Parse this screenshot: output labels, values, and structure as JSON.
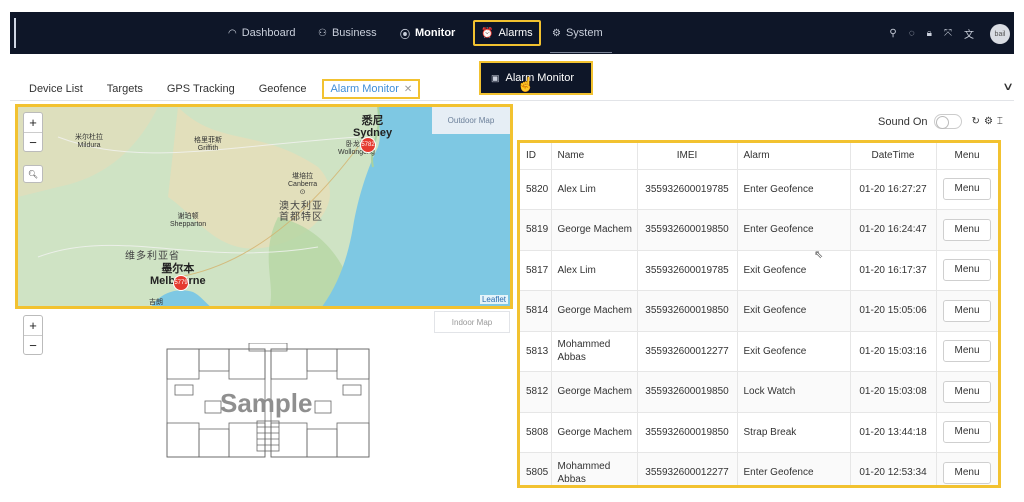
{
  "nav": {
    "dashboard": "Dashboard",
    "business": "Business",
    "monitor": "Monitor",
    "alarms": "Alarms",
    "system": "System",
    "avatar_text": "bail"
  },
  "dropdown": {
    "alarm_monitor": "Alarm Monitor"
  },
  "tabs": [
    {
      "label": "Device List"
    },
    {
      "label": "Targets"
    },
    {
      "label": "GPS Tracking"
    },
    {
      "label": "Geofence"
    },
    {
      "label": "Alarm Monitor",
      "active": true
    }
  ],
  "map": {
    "layer_button": "Outdoor Map",
    "attribution": "Leaflet",
    "labels": {
      "sydney_cn": "悉尼",
      "sydney": "Sydney",
      "wollongong_cn": "卧龙岗",
      "wollongong": "Wollongong",
      "mildura_cn": "米尔杜拉",
      "mildura": "Mildura",
      "griffith_cn": "格里菲斯",
      "griffith": "Griffith",
      "canberra_cn": "堪培拉",
      "canberra": "Canberra",
      "act_cn": "澳大利亚首都特区",
      "shepparton_cn": "谢珀顿",
      "shepparton": "Shepparton",
      "victoria_cn": "维多利亚省",
      "melbourne_cn": "墨尔本",
      "melbourne": "Melbourne",
      "geelong_cn": "吉朗"
    },
    "pins": [
      "5782",
      "5779"
    ]
  },
  "indoor": {
    "layer_button": "Indoor Map",
    "watermark": "Sample"
  },
  "table_tools": {
    "sound_label": "Sound On",
    "sound_on": false
  },
  "alarm_table": {
    "headers": [
      "ID",
      "Name",
      "IMEI",
      "Alarm",
      "DateTime",
      "Menu"
    ],
    "menu_label": "Menu",
    "rows": [
      {
        "id": "5820",
        "name": "Alex Lim",
        "imei": "355932600019785",
        "alarm": "Enter Geofence",
        "datetime": "01-20 16:27:27"
      },
      {
        "id": "5819",
        "name": "George Machem",
        "imei": "355932600019850",
        "alarm": "Enter Geofence",
        "datetime": "01-20 16:24:47"
      },
      {
        "id": "5817",
        "name": "Alex Lim",
        "imei": "355932600019785",
        "alarm": "Exit Geofence",
        "datetime": "01-20 16:17:37"
      },
      {
        "id": "5814",
        "name": "George Machem",
        "imei": "355932600019850",
        "alarm": "Exit Geofence",
        "datetime": "01-20 15:05:06"
      },
      {
        "id": "5813",
        "name": "Mohammed Abbas",
        "imei": "355932600012277",
        "alarm": "Exit Geofence",
        "datetime": "01-20 15:03:16"
      },
      {
        "id": "5812",
        "name": "George Machem",
        "imei": "355932600019850",
        "alarm": "Lock Watch",
        "datetime": "01-20 15:03:08"
      },
      {
        "id": "5808",
        "name": "George Machem",
        "imei": "355932600019850",
        "alarm": "Strap Break",
        "datetime": "01-20 13:44:18"
      },
      {
        "id": "5805",
        "name": "Mohammed Abbas",
        "imei": "355932600012277",
        "alarm": "Enter Geofence",
        "datetime": "01-20 12:53:34"
      }
    ]
  },
  "colors": {
    "topbar": "#0e1628",
    "highlight": "#f2c230",
    "tab_active": "#3f8ed8",
    "pin": "#e53a2f",
    "sea": "#7ec8e3",
    "land": "#cfe3c4"
  }
}
